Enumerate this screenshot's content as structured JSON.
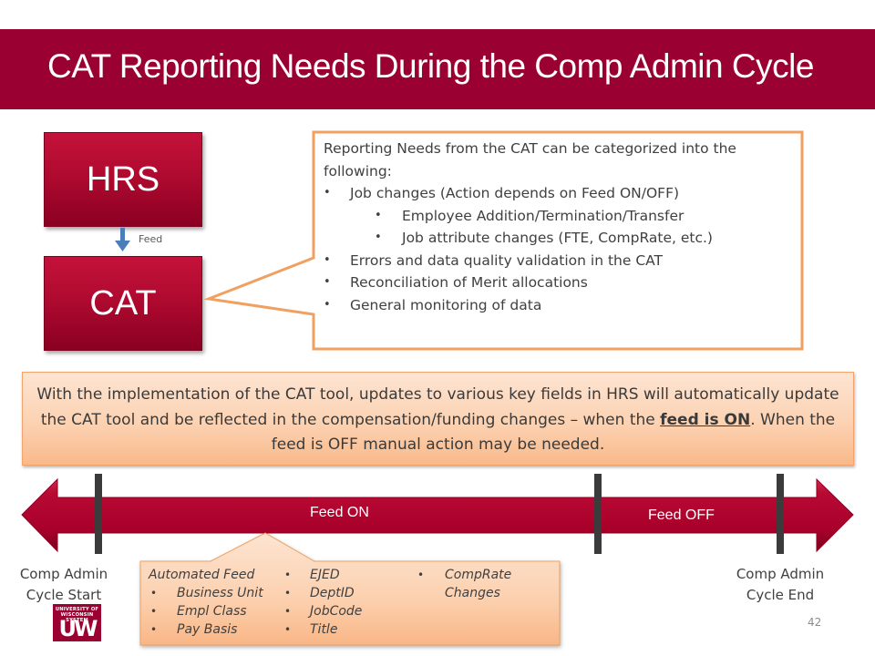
{
  "slide": {
    "title": "CAT Reporting Needs During the Comp Admin Cycle",
    "page_number": "42",
    "colors": {
      "brand": "#9b0032",
      "callout_border": "#f0a060",
      "peach_fill": "#fcd2b2",
      "feed_arrow": "#4a7ebb",
      "marker": "#3b3b3b"
    }
  },
  "systems": {
    "source": "HRS",
    "target": "CAT",
    "connector_label": "Feed",
    "connector_icon": "arrow-down-icon"
  },
  "reporting_needs": {
    "intro": "Reporting Needs from the CAT can be categorized into the following:",
    "items": [
      {
        "text": "Job changes (Action depends on Feed ON/OFF)",
        "level": 1
      },
      {
        "text": "Employee  Addition/Termination/Transfer",
        "level": 2
      },
      {
        "text": "Job attribute changes (FTE, CompRate, etc.)",
        "level": 2
      },
      {
        "text": "Errors and data quality validation in the CAT",
        "level": 1
      },
      {
        "text": "Reconciliation of Merit allocations",
        "level": 1
      },
      {
        "text": "General monitoring of data",
        "level": 1
      }
    ]
  },
  "info": {
    "part1": "With the implementation of the CAT tool, updates to various key fields in HRS will automatically update the CAT tool and be reflected in the compensation/funding changes – when the ",
    "emphasis": "feed is ON",
    "part2": ". When the feed is OFF manual action may be needed."
  },
  "timeline": {
    "segments": [
      {
        "label": "Feed ON"
      },
      {
        "label": "Feed OFF"
      }
    ],
    "start_label": [
      "Comp Admin",
      "Cycle Start"
    ],
    "end_label": [
      "Comp Admin",
      "Cycle End"
    ]
  },
  "automated_feed": {
    "heading": "Automated Feed",
    "columns": [
      [
        "Business Unit",
        "Empl Class",
        "Pay Basis"
      ],
      [
        "EJED",
        "DeptID",
        "JobCode",
        "Title"
      ],
      [
        "CompRate Changes"
      ]
    ]
  },
  "logo": {
    "line1": "UNIVERSITY OF",
    "line2": "WISCONSIN SYSTEM",
    "mark": "UW"
  }
}
